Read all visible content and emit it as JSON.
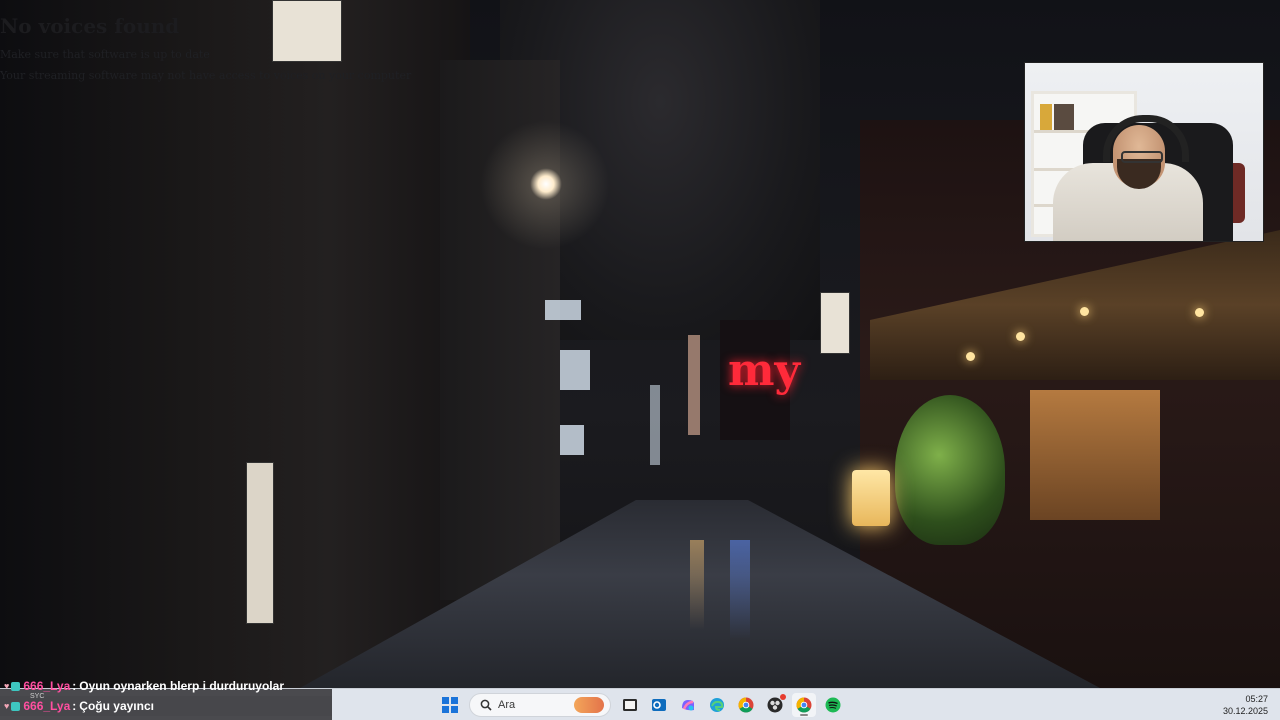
{
  "overlay": {
    "title": "No voices found",
    "line1": "Make sure that software is up to date",
    "line2": "Your streaming software may not have access to voices on your computer"
  },
  "chat": {
    "messages": [
      {
        "user": "666_Lya",
        "separator": ":",
        "text": "Oyun oynarken blerp i durduruyolar"
      },
      {
        "user": "666_Lya",
        "separator": ":",
        "text": "Çoğu yayıncı"
      }
    ],
    "tiny_note": "SYC"
  },
  "taskbar": {
    "search_placeholder": "Ara",
    "apps": [
      "windows-start",
      "search",
      "file-explorer",
      "outlook",
      "copilot",
      "edge",
      "chrome",
      "obs",
      "chrome-active",
      "spotify"
    ],
    "clock": {
      "time": "05:27",
      "date": "30.12.2025"
    }
  },
  "colors": {
    "chat_username": "#ff4fa0",
    "chat_text": "#ffffff",
    "taskbar_bg": "#dfe4ec",
    "accent": "#1a73d9"
  }
}
